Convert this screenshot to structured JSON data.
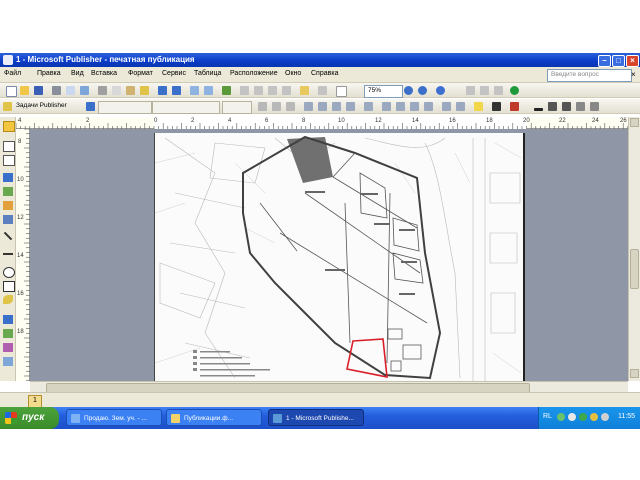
{
  "window": {
    "title": "1 - Microsoft Publisher - печатная публикация"
  },
  "menu": {
    "items": [
      "Файл",
      "Правка",
      "Вид",
      "Вставка",
      "Формат",
      "Сервис",
      "Таблица",
      "Расположение",
      "Окно",
      "Справка"
    ],
    "help_placeholder": "Введите вопрос",
    "close_symbol": "×"
  },
  "toolbar": {
    "zoom": "75%",
    "task_pane_label": "Задачи Publisher"
  },
  "ruler": {
    "horizontal_labels": [
      "4",
      "2",
      "0",
      "2",
      "4",
      "6",
      "8",
      "10",
      "12",
      "14",
      "16",
      "18",
      "20",
      "22",
      "24",
      "26"
    ],
    "vertical_labels": [
      "8",
      "10",
      "12",
      "14",
      "16",
      "18"
    ]
  },
  "status": {
    "page_number": "1"
  },
  "taskbar": {
    "start_label": "пуск",
    "tasks": [
      {
        "label": "Продаю. Зем. уч. - ..."
      },
      {
        "label": "Публикации.ф..."
      },
      {
        "label": "1 - Microsoft Publishe..."
      }
    ],
    "language": "RL",
    "clock": "11:55"
  },
  "colors": {
    "titlebar": "#0a3cc7",
    "taskbar": "#245edc",
    "start": "#3a8c2a",
    "canvas": "#8f97a7",
    "highlight": "#d9202a"
  }
}
